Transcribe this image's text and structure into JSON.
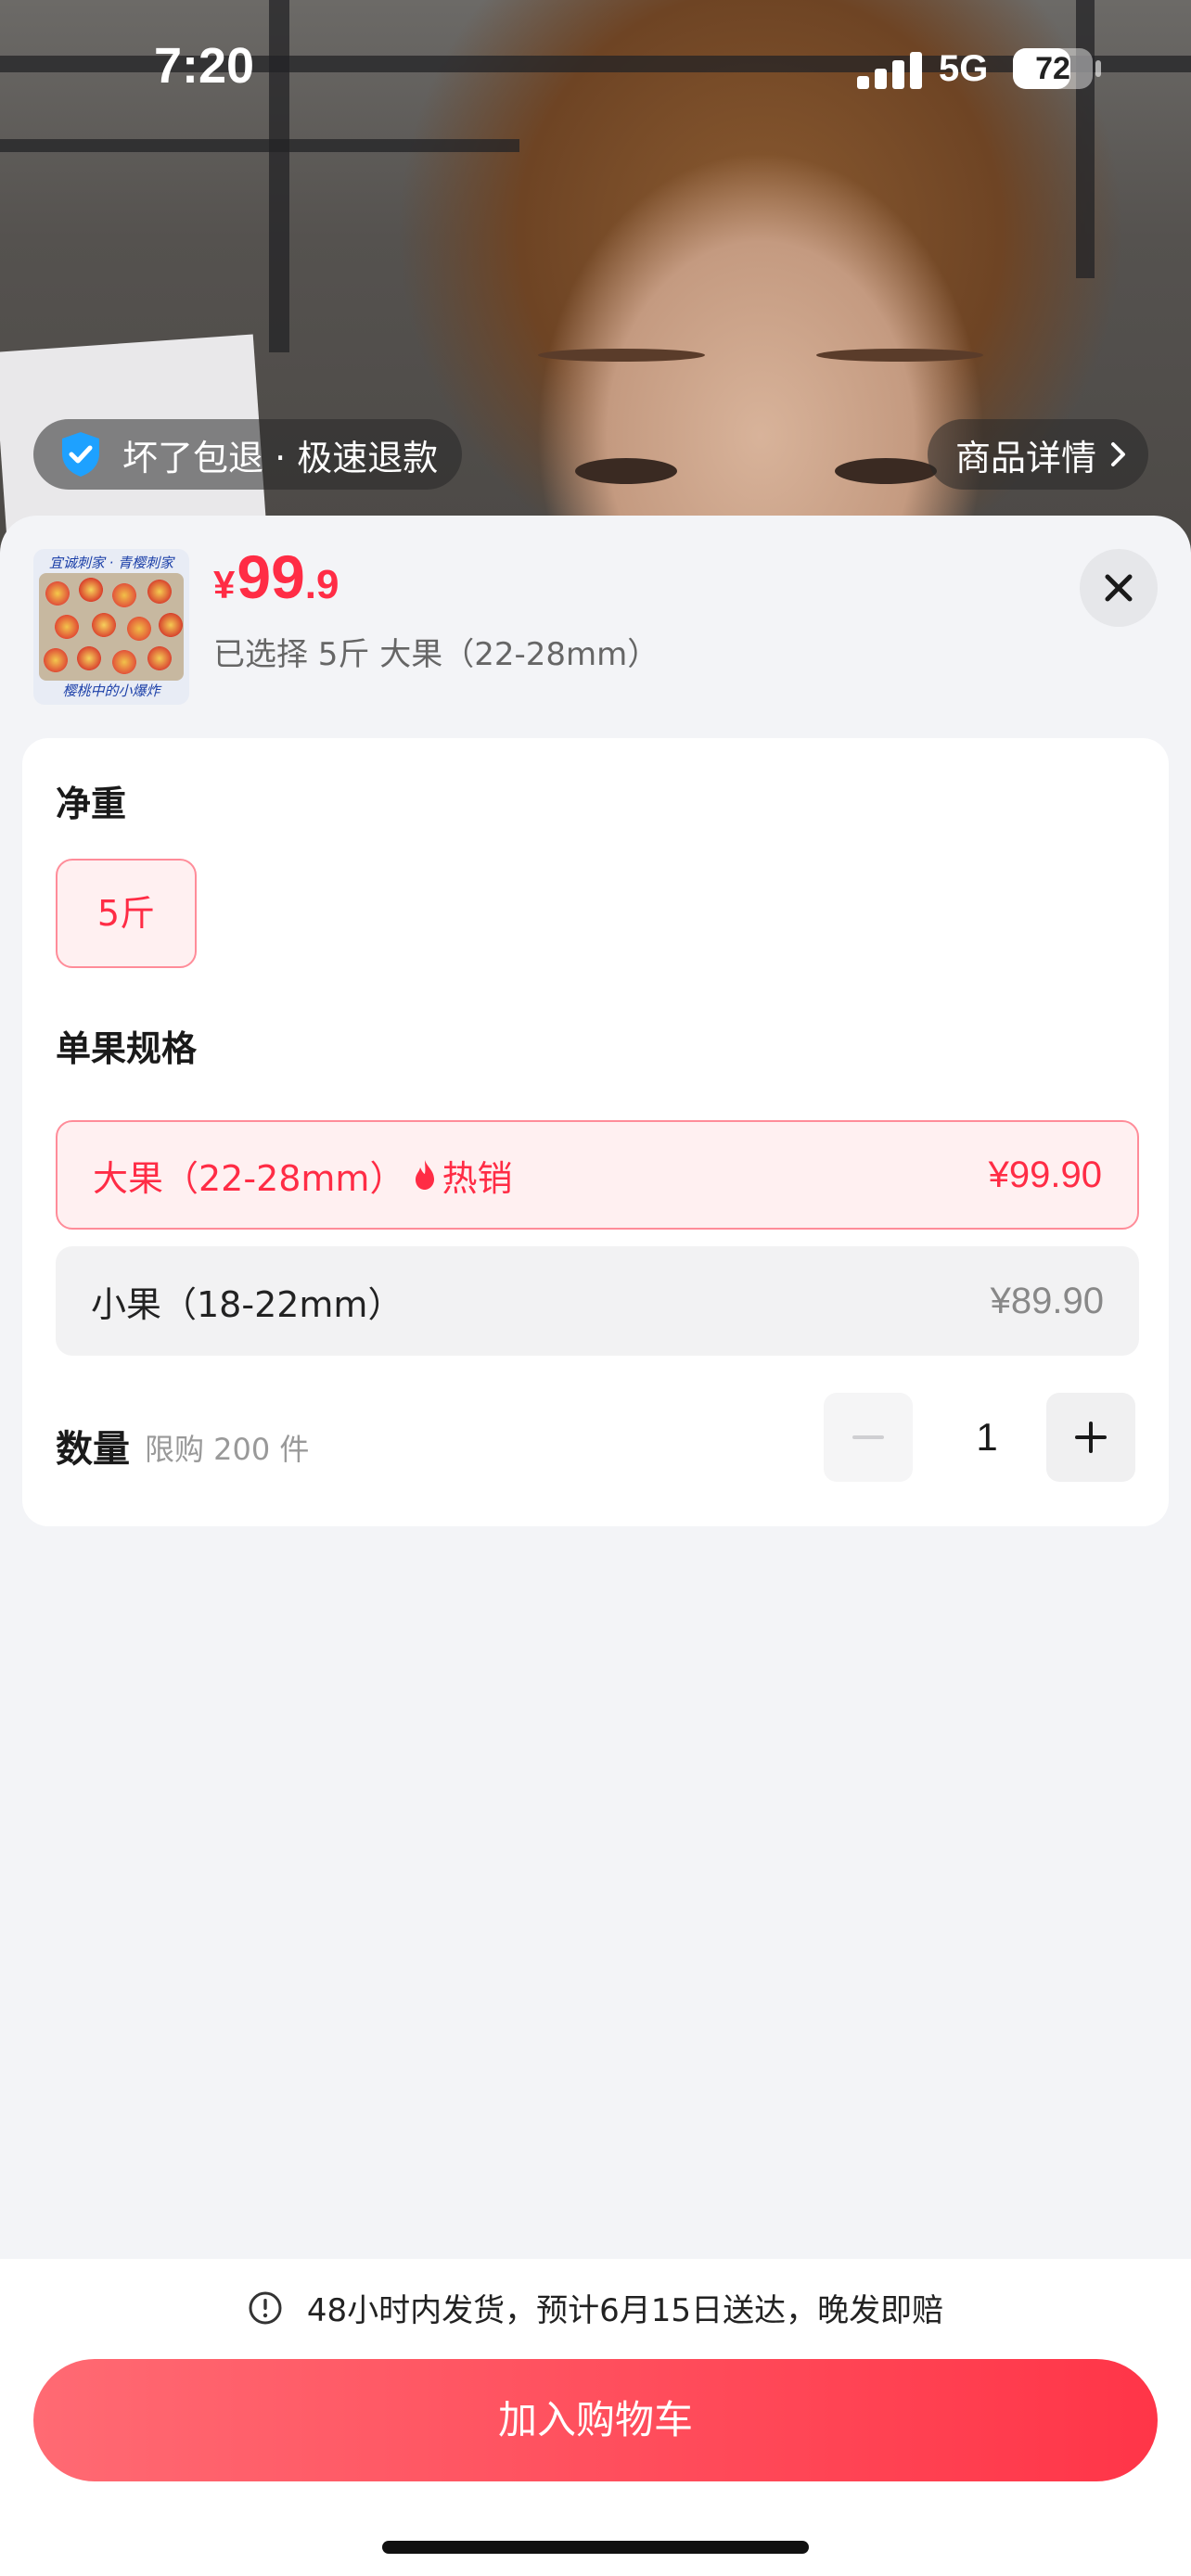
{
  "status_bar": {
    "time": "7:20",
    "network": "5G",
    "battery_level": "72",
    "battery_fraction": 0.72
  },
  "overlay": {
    "guarantee_text": "坏了包退 · 极速退款",
    "detail_text": "商品详情"
  },
  "product": {
    "thumbnail_text_top": "宜诚刺家 · 青樱刺家",
    "thumbnail_text_bottom": "樱桃中的小爆炸",
    "currency": "¥",
    "price_int": "99",
    "price_dec": ".9",
    "selected_summary": "已选择 5斤 大果（22-28mm）"
  },
  "options": {
    "weight_label": "净重",
    "weight_choices": [
      {
        "label": "5斤",
        "selected": true
      }
    ],
    "spec_label": "单果规格",
    "specs": [
      {
        "label": "大果（22-28mm）",
        "tag": "热销",
        "price": "¥99.90",
        "selected": true
      },
      {
        "label": "小果（18-22mm）",
        "tag": "",
        "price": "¥89.90",
        "selected": false
      }
    ]
  },
  "quantity": {
    "label": "数量",
    "limit": "限购 200 件",
    "value": "1"
  },
  "footer": {
    "shipping_note": "48小时内发货，预计6月15日送达，晚发即赔",
    "add_to_cart": "加入购物车"
  },
  "colors": {
    "accent": "#ff2c45",
    "chip_bg": "#fff0f1",
    "chip_border": "#ff8c99",
    "button_gradient_start": "#ff6a73",
    "button_gradient_end": "#ff3548",
    "shield": "#1ea1ff"
  },
  "icons": {
    "shield": "shield-check-icon",
    "chevron": "chevron-right-icon",
    "close": "close-icon",
    "fire": "fire-icon",
    "minus": "minus-icon",
    "plus": "plus-icon",
    "info": "info-circle-icon"
  }
}
